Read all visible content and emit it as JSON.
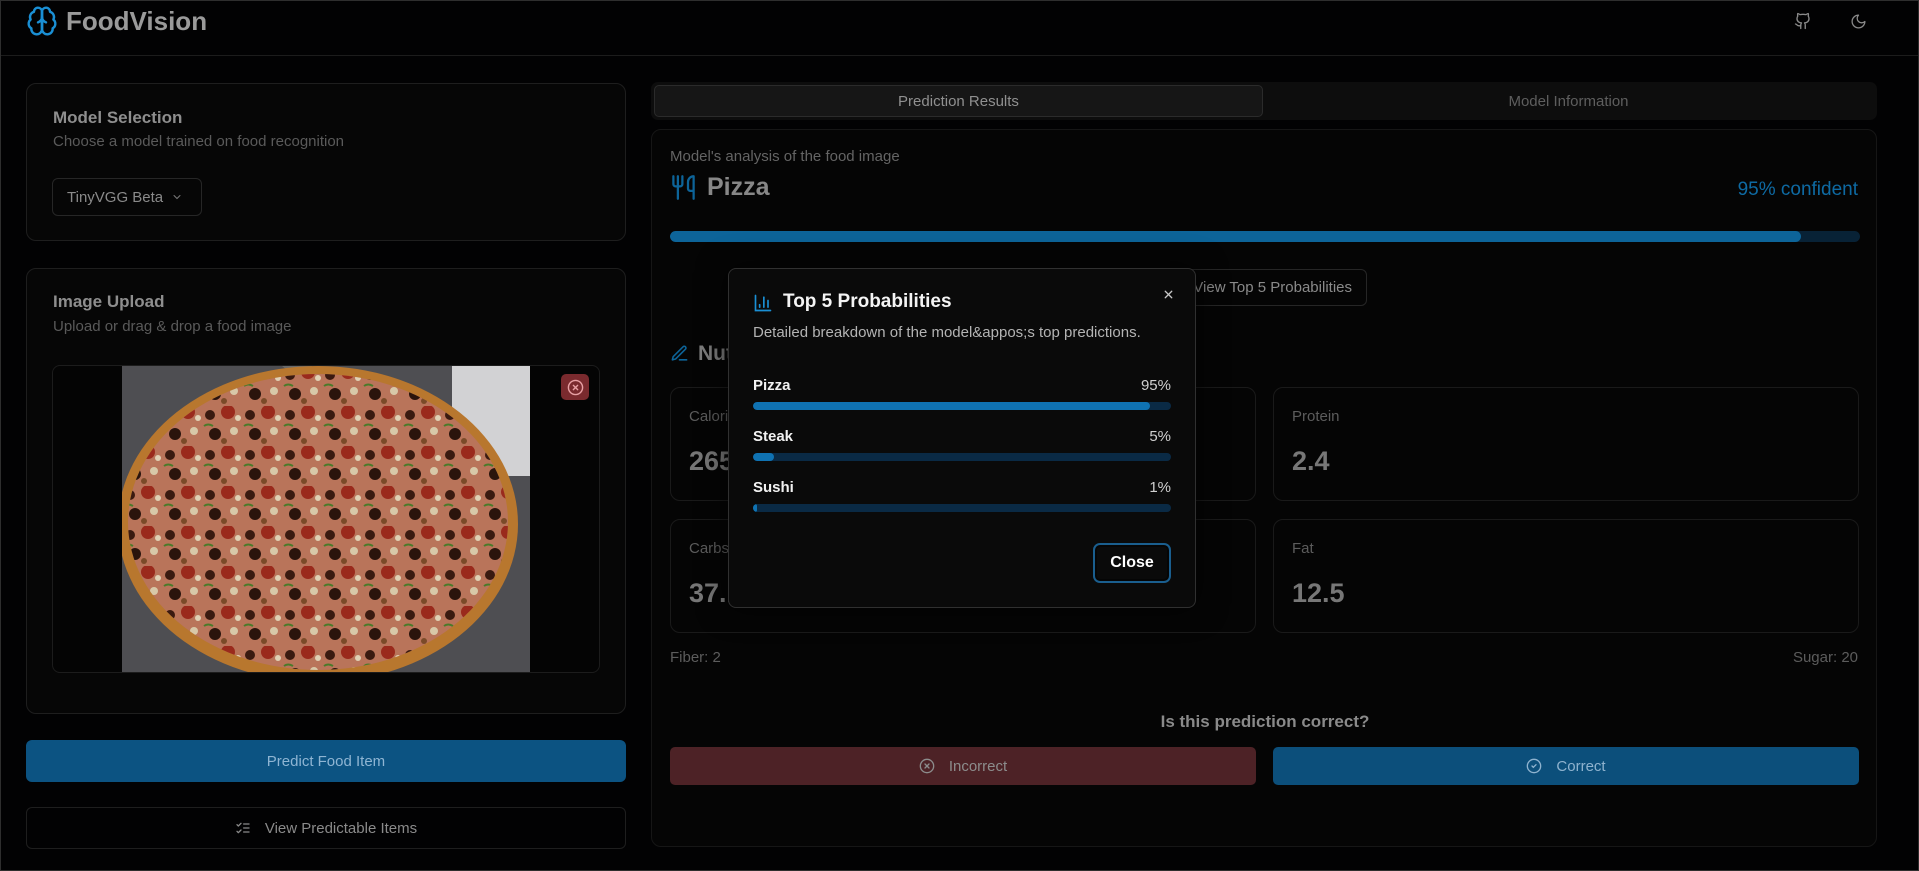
{
  "app": {
    "name": "FoodVision"
  },
  "model_selection": {
    "title": "Model Selection",
    "subtitle": "Choose a model trained on food recognition",
    "selected_model": "TinyVGG Beta"
  },
  "image_upload": {
    "title": "Image Upload",
    "subtitle": "Upload or drag & drop a food image"
  },
  "buttons": {
    "predict": "Predict Food Item",
    "view_items": "View Predictable Items"
  },
  "tabs": [
    {
      "label": "Prediction Results",
      "active": true
    },
    {
      "label": "Model Information",
      "active": false
    }
  ],
  "results": {
    "caption": "Model's analysis of the food image",
    "food": "Pizza",
    "confidence_text": "95% confident",
    "confidence": 0.95,
    "top5_button": "View Top 5 Probabilities",
    "nutrition_title": "Nutrition Facts",
    "nutrition": [
      {
        "label": "Calories",
        "value": "265"
      },
      {
        "label": "Protein",
        "value": "2.4"
      },
      {
        "label": "Carbs",
        "value": "37.1"
      },
      {
        "label": "Fat",
        "value": "12.5"
      }
    ],
    "fiber": "Fiber: 2",
    "sugar": "Sugar: 20",
    "feedback_question": "Is this prediction correct?",
    "incorrect_label": "Incorrect",
    "correct_label": "Correct"
  },
  "modal": {
    "title": "Top 5 Probabilities",
    "description": "Detailed breakdown of the model&appos;s top predictions.",
    "items": [
      {
        "name": "Pizza",
        "pct": "95%",
        "value": 0.95
      },
      {
        "name": "Steak",
        "pct": "5%",
        "value": 0.05
      },
      {
        "name": "Sushi",
        "pct": "1%",
        "value": 0.01
      }
    ],
    "close_label": "Close"
  },
  "colors": {
    "accent": "#0d6499",
    "incorrect": "#4d2226",
    "background": "#020203"
  }
}
